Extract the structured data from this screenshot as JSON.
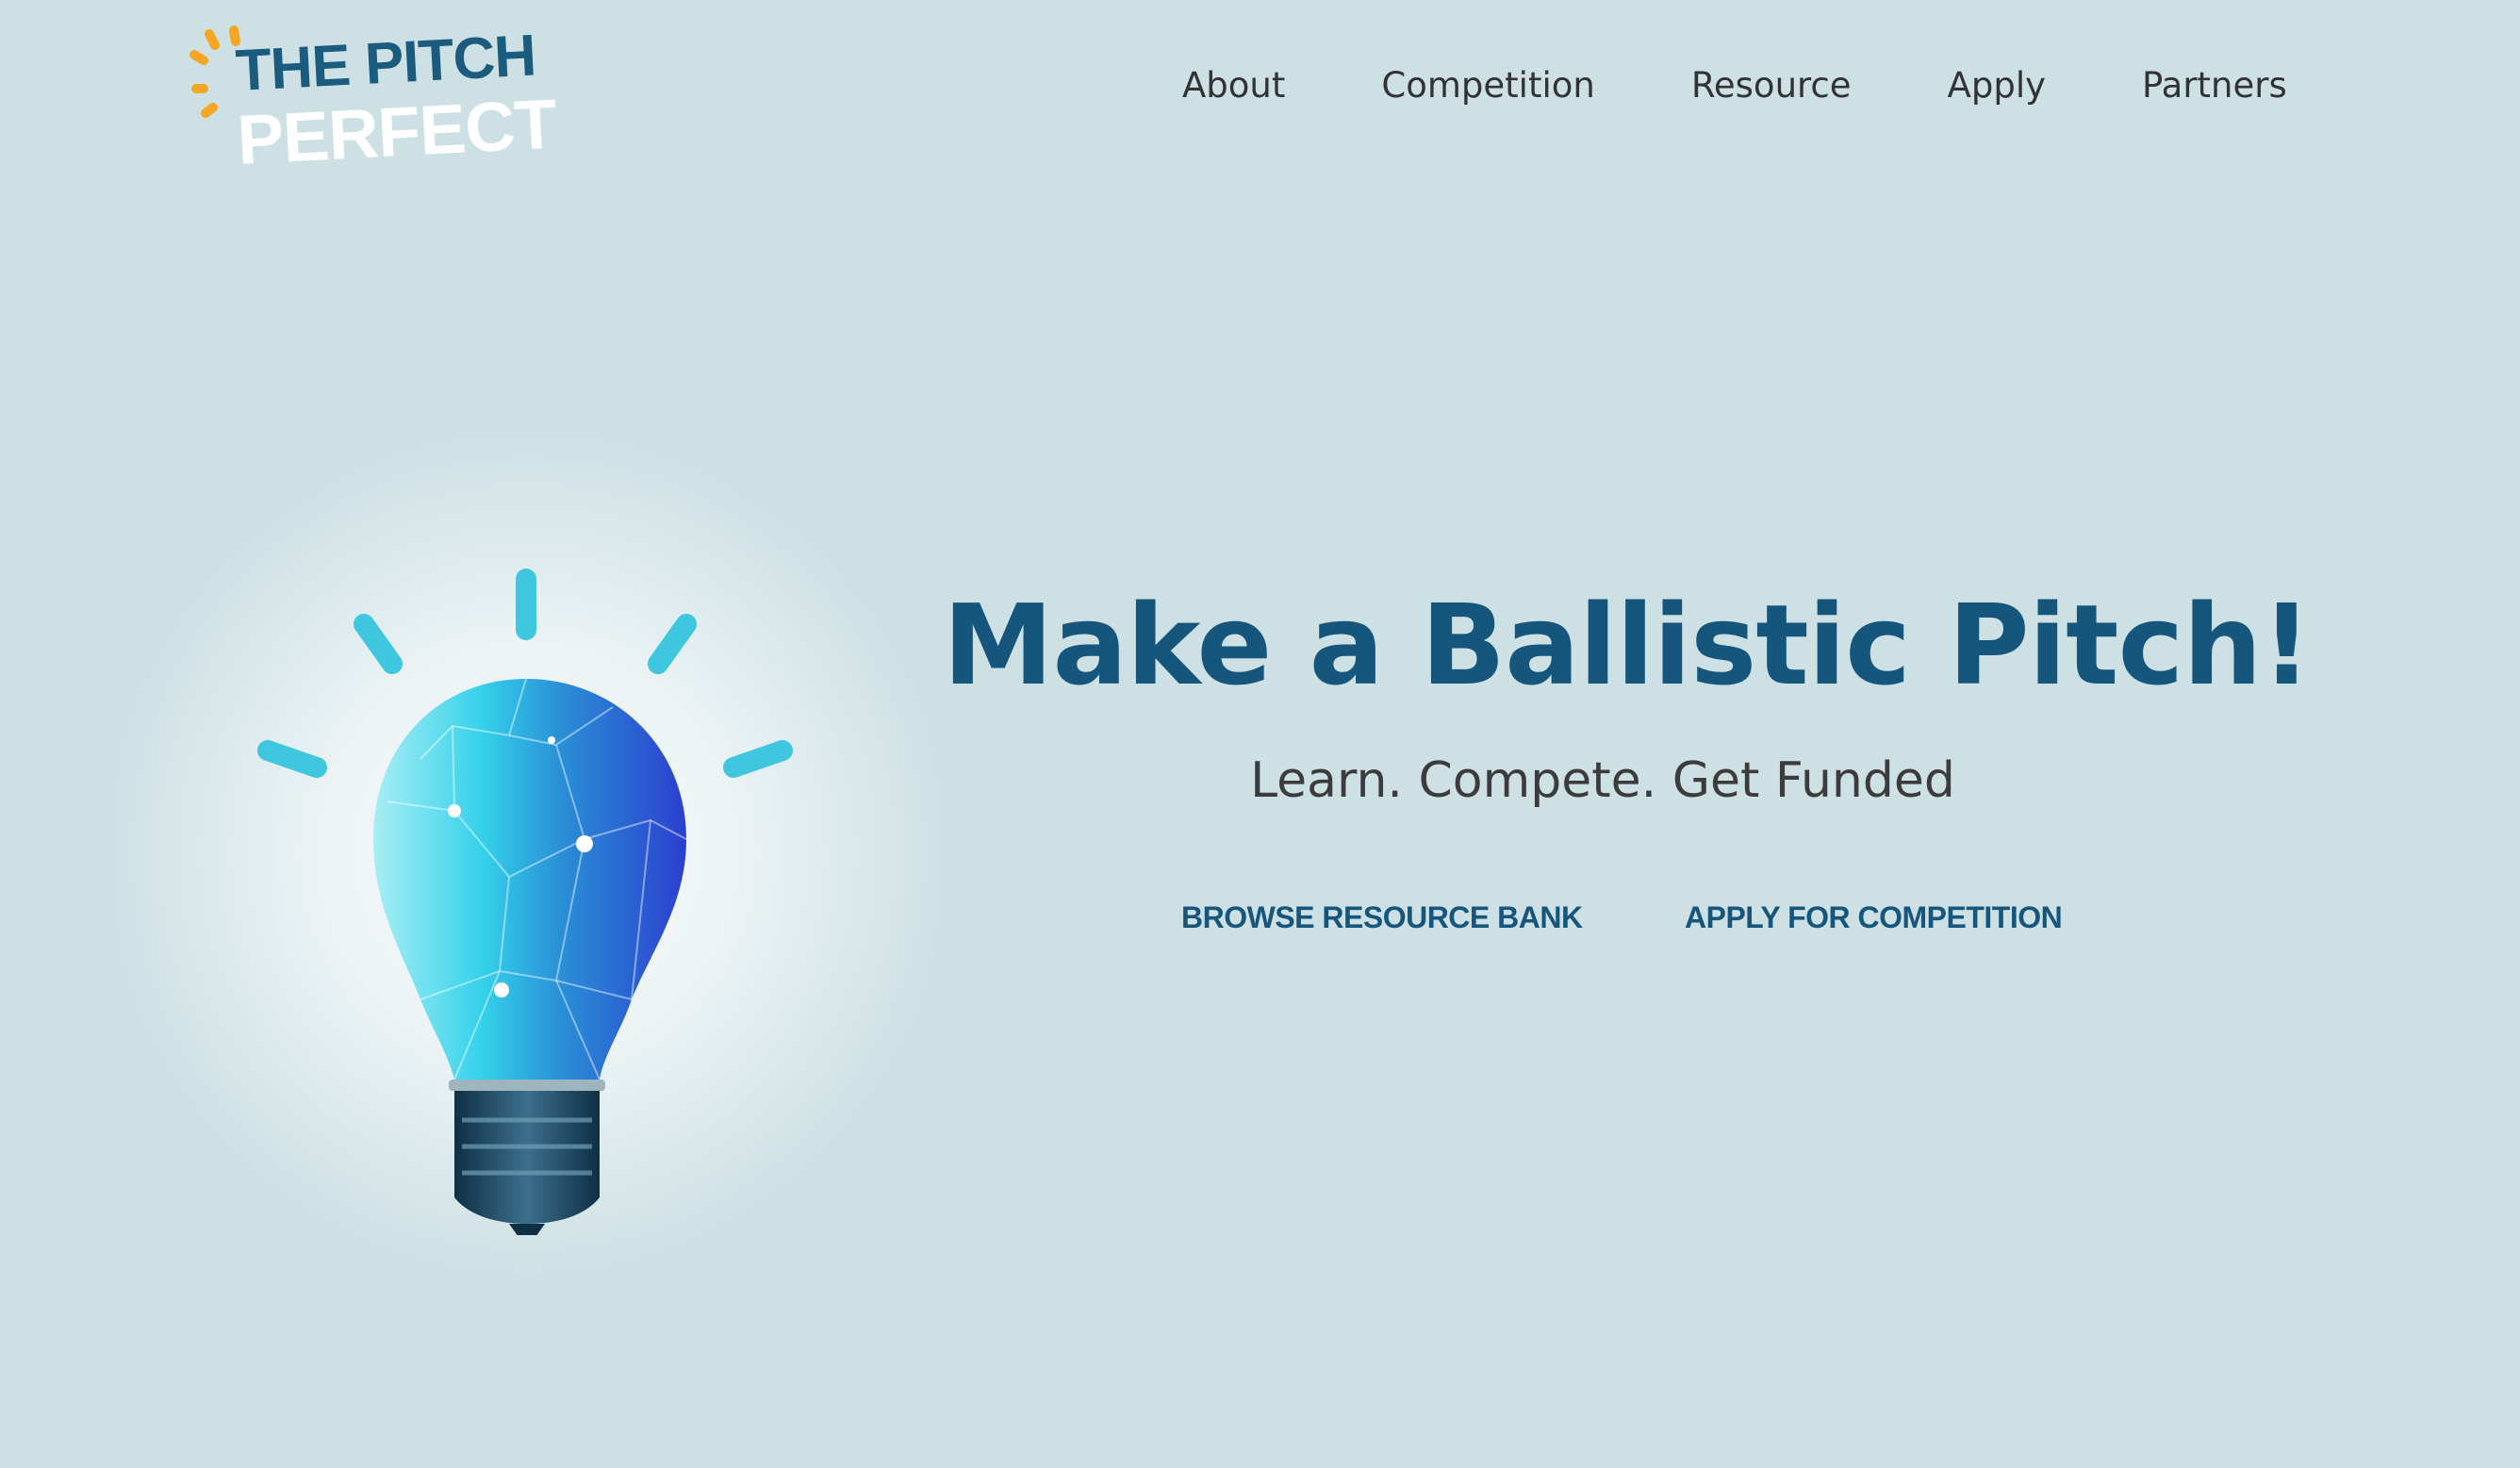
{
  "brand": {
    "logo_line1": "THE PITCH",
    "logo_line2": "PERFECT",
    "accent_color": "#f5a623",
    "primary_color": "#17567c"
  },
  "nav": {
    "items": [
      {
        "label": "About"
      },
      {
        "label": "Competition"
      },
      {
        "label": "Resource"
      },
      {
        "label": "Apply"
      },
      {
        "label": "Partners"
      }
    ]
  },
  "hero": {
    "title": "Make a Ballistic Pitch!",
    "subtitle": "Learn. Compete. Get Funded",
    "illustration_icon": "lightbulb-icon",
    "buttons": [
      {
        "label": "BROWSE RESOURCE BANK"
      },
      {
        "label": "APPLY FOR COMPETITION"
      }
    ]
  },
  "colors": {
    "background": "#cde0e4",
    "nav_text": "#333333",
    "subtitle_text": "#3c3c3c"
  }
}
